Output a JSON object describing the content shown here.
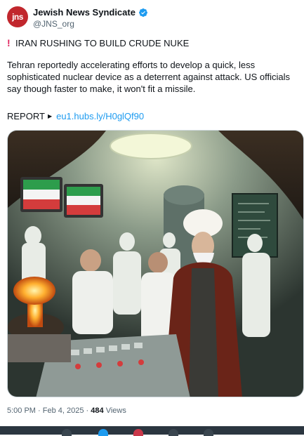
{
  "author": {
    "avatar_text": "jns",
    "display_name": "Jewish News Syndicate",
    "handle": "@JNS_org",
    "avatar_color": "#c1272d",
    "verified_color": "#1d9bf0"
  },
  "post": {
    "alert_icon": "!",
    "headline": "IRAN RUSHING TO BUILD CRUDE NUKE",
    "body": "Tehran reportedly accelerating efforts to develop a quick, less sophisticated nuclear device as a deterrent against attack. US officials say though faster to make, it won't fit a missile.",
    "report_label": "REPORT",
    "report_icon": "play-triangle-icon",
    "link_text": "eu1.hubs.ly/H0glQf90"
  },
  "image": {
    "description_icon": "illustration"
  },
  "meta": {
    "time": "5:00 PM",
    "separator": "·",
    "date": "Feb 4, 2025",
    "separator2": "·",
    "views_count": "484",
    "views_label": "Views"
  },
  "colors": {
    "link": "#1d9bf0",
    "muted": "#536471",
    "border": "#cfd9de"
  }
}
